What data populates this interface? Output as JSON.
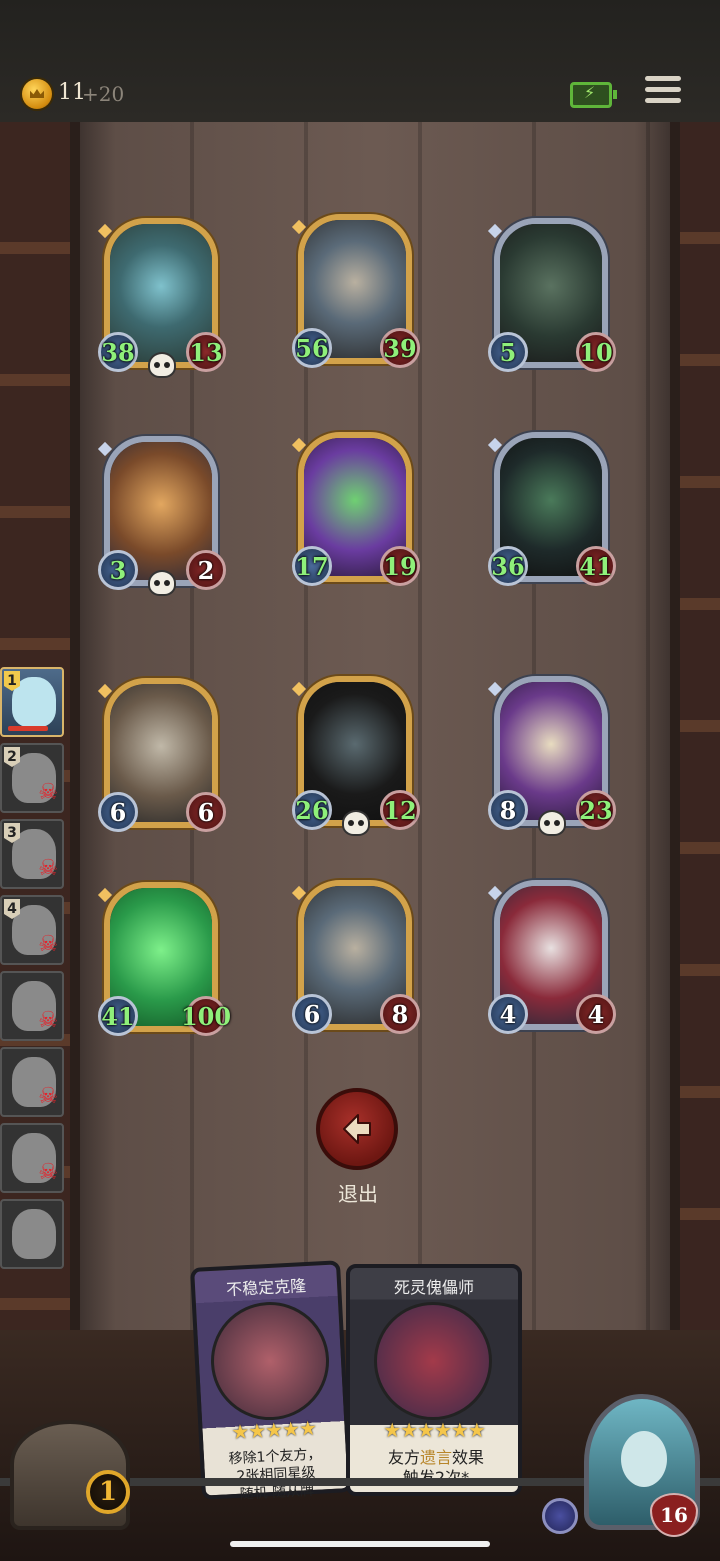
{
  "header": {
    "gold": "11",
    "gold_gain": "+20",
    "coin_icon": "crown-coin-icon",
    "battery_icon": "battery-charging-icon",
    "menu_icon": "hamburger-menu-icon",
    "colors": {
      "battery": "#5fb63a",
      "coin": "#f2b531"
    }
  },
  "board": {
    "cards": [
      {
        "name": "bunny",
        "frame": "gold",
        "attack": "38",
        "health": "13",
        "attack_buffed": true,
        "health_buffed": true,
        "skull": true
      },
      {
        "name": "horned-demon",
        "frame": "gold",
        "attack": "56",
        "health": "39",
        "attack_buffed": true,
        "health_buffed": true,
        "skull": false
      },
      {
        "name": "skeleton",
        "frame": "silver",
        "attack": "5",
        "health": "10",
        "attack_buffed": true,
        "health_buffed": true,
        "skull": false
      },
      {
        "name": "pinocchio",
        "frame": "silver",
        "attack": "3",
        "health": "2",
        "attack_buffed": true,
        "health_buffed": false,
        "skull": true
      },
      {
        "name": "frog-dragon",
        "frame": "gold",
        "attack": "17",
        "health": "19",
        "attack_buffed": true,
        "health_buffed": true,
        "skull": false
      },
      {
        "name": "shadow-beast",
        "frame": "silver",
        "attack": "36",
        "health": "41",
        "attack_buffed": true,
        "health_buffed": true,
        "skull": false
      },
      {
        "name": "rocket-ship",
        "frame": "gold",
        "attack": "6",
        "health": "6",
        "attack_buffed": false,
        "health_buffed": false,
        "skull": false
      },
      {
        "name": "hooded-ghoul",
        "frame": "gold",
        "attack": "26",
        "health": "12",
        "attack_buffed": true,
        "health_buffed": true,
        "skull": true
      },
      {
        "name": "bone-dragon",
        "frame": "silver",
        "attack": "8",
        "health": "23",
        "attack_buffed": false,
        "health_buffed": true,
        "skull": true
      },
      {
        "name": "spectral-warrior",
        "frame": "gold",
        "attack": "41",
        "health": "100",
        "attack_buffed": true,
        "health_buffed": true,
        "skull": false
      },
      {
        "name": "horned-demon",
        "frame": "gold",
        "attack": "6",
        "health": "8",
        "attack_buffed": false,
        "health_buffed": false,
        "skull": false
      },
      {
        "name": "clown-puppet",
        "frame": "silver",
        "attack": "4",
        "health": "4",
        "attack_buffed": false,
        "health_buffed": false,
        "skull": false
      }
    ]
  },
  "sidebar": {
    "players": [
      {
        "rank": "1",
        "active": true,
        "eliminated": false
      },
      {
        "rank": "2",
        "active": false,
        "eliminated": true
      },
      {
        "rank": "3",
        "active": false,
        "eliminated": true
      },
      {
        "rank": "4",
        "active": false,
        "eliminated": true
      },
      {
        "rank": "",
        "active": false,
        "eliminated": true
      },
      {
        "rank": "",
        "active": false,
        "eliminated": true
      },
      {
        "rank": "",
        "active": false,
        "eliminated": true
      },
      {
        "rank": "",
        "active": false,
        "eliminated": false
      }
    ]
  },
  "exit": {
    "label": "退出",
    "icon": "arrow-left-icon"
  },
  "hand": {
    "cards": [
      {
        "title": "不稳定克隆",
        "stars": "★★★★★",
        "desc_line1": "移除1个友方，",
        "desc_line2": "2张相同星级",
        "desc_line3": "随机 随从牌"
      },
      {
        "title": "死灵傀儡师",
        "stars": "★★★★★★",
        "desc_pre": "友方",
        "desc_highlight": "遗言",
        "desc_post": "效果",
        "desc_line2": "触发2次*"
      }
    ]
  },
  "shop": {
    "tier": "1",
    "icon": "treasure-chest-icon"
  },
  "hero": {
    "health": "16",
    "shield_icon": "shield-icon"
  }
}
